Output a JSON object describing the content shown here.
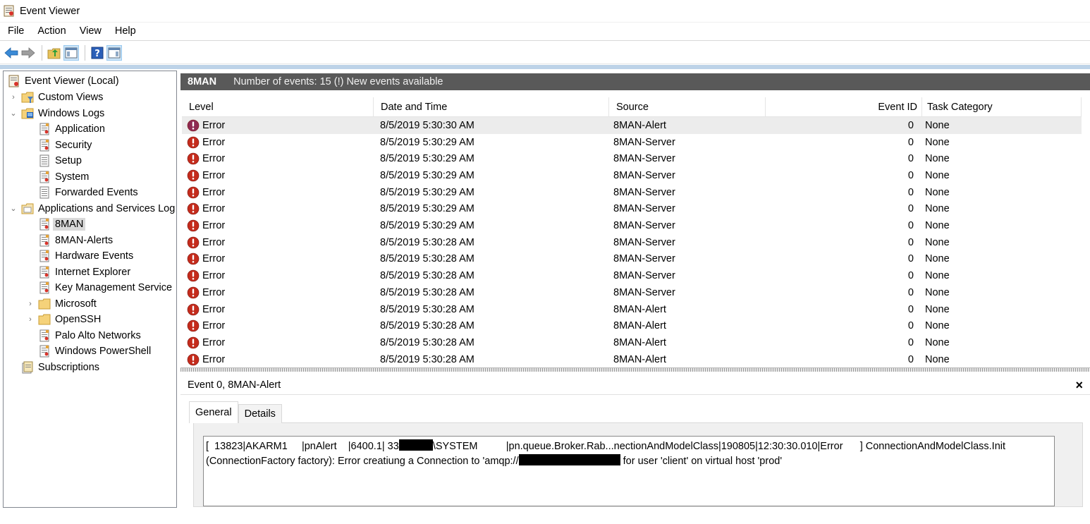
{
  "window": {
    "title": "Event Viewer"
  },
  "menu": [
    "File",
    "Action",
    "View",
    "Help"
  ],
  "toolbar": [
    "back-icon",
    "forward-icon",
    "up-folder-icon",
    "show-hide-console-tree-icon",
    "help-icon",
    "show-hide-action-pane-icon"
  ],
  "tree": {
    "root": "Event Viewer (Local)",
    "items": [
      {
        "label": "Custom Views",
        "icon": "custom-views-icon",
        "expander": "›",
        "level": 1
      },
      {
        "label": "Windows Logs",
        "icon": "windows-logs-icon",
        "expander": "⌄",
        "level": 1
      },
      {
        "label": "Application",
        "icon": "log-icon",
        "level": 2
      },
      {
        "label": "Security",
        "icon": "log-icon",
        "level": 2
      },
      {
        "label": "Setup",
        "icon": "log-plain-icon",
        "level": 2
      },
      {
        "label": "System",
        "icon": "log-icon",
        "level": 2
      },
      {
        "label": "Forwarded Events",
        "icon": "log-plain-icon",
        "level": 2
      },
      {
        "label": "Applications and Services Log",
        "icon": "folder-open-icon",
        "expander": "⌄",
        "level": 1
      },
      {
        "label": "8MAN",
        "icon": "log-icon",
        "level": 2,
        "selected": true
      },
      {
        "label": "8MAN-Alerts",
        "icon": "log-icon",
        "level": 2
      },
      {
        "label": "Hardware Events",
        "icon": "log-icon",
        "level": 2
      },
      {
        "label": "Internet Explorer",
        "icon": "log-icon",
        "level": 2
      },
      {
        "label": "Key Management Service",
        "icon": "log-icon",
        "level": 2
      },
      {
        "label": "Microsoft",
        "icon": "folder-icon",
        "expander": "›",
        "level": 2
      },
      {
        "label": "OpenSSH",
        "icon": "folder-icon",
        "expander": "›",
        "level": 2
      },
      {
        "label": "Palo Alto Networks",
        "icon": "log-icon",
        "level": 2
      },
      {
        "label": "Windows PowerShell",
        "icon": "log-icon",
        "level": 2
      },
      {
        "label": "Subscriptions",
        "icon": "subscriptions-icon",
        "level": 1
      }
    ]
  },
  "log": {
    "name": "8MAN",
    "info": "Number of events: 15 (!) New events available"
  },
  "grid": {
    "columns": [
      "Level",
      "Date and Time",
      "Source",
      "Event ID",
      "Task Category"
    ],
    "rows": [
      {
        "level": "Error",
        "date": "8/5/2019 5:30:30 AM",
        "source": "8MAN-Alert",
        "eid": "0",
        "task": "None",
        "selected": true
      },
      {
        "level": "Error",
        "date": "8/5/2019 5:30:29 AM",
        "source": "8MAN-Server",
        "eid": "0",
        "task": "None"
      },
      {
        "level": "Error",
        "date": "8/5/2019 5:30:29 AM",
        "source": "8MAN-Server",
        "eid": "0",
        "task": "None"
      },
      {
        "level": "Error",
        "date": "8/5/2019 5:30:29 AM",
        "source": "8MAN-Server",
        "eid": "0",
        "task": "None"
      },
      {
        "level": "Error",
        "date": "8/5/2019 5:30:29 AM",
        "source": "8MAN-Server",
        "eid": "0",
        "task": "None"
      },
      {
        "level": "Error",
        "date": "8/5/2019 5:30:29 AM",
        "source": "8MAN-Server",
        "eid": "0",
        "task": "None"
      },
      {
        "level": "Error",
        "date": "8/5/2019 5:30:29 AM",
        "source": "8MAN-Server",
        "eid": "0",
        "task": "None"
      },
      {
        "level": "Error",
        "date": "8/5/2019 5:30:28 AM",
        "source": "8MAN-Server",
        "eid": "0",
        "task": "None"
      },
      {
        "level": "Error",
        "date": "8/5/2019 5:30:28 AM",
        "source": "8MAN-Server",
        "eid": "0",
        "task": "None"
      },
      {
        "level": "Error",
        "date": "8/5/2019 5:30:28 AM",
        "source": "8MAN-Server",
        "eid": "0",
        "task": "None"
      },
      {
        "level": "Error",
        "date": "8/5/2019 5:30:28 AM",
        "source": "8MAN-Server",
        "eid": "0",
        "task": "None"
      },
      {
        "level": "Error",
        "date": "8/5/2019 5:30:28 AM",
        "source": "8MAN-Alert",
        "eid": "0",
        "task": "None"
      },
      {
        "level": "Error",
        "date": "8/5/2019 5:30:28 AM",
        "source": "8MAN-Alert",
        "eid": "0",
        "task": "None"
      },
      {
        "level": "Error",
        "date": "8/5/2019 5:30:28 AM",
        "source": "8MAN-Alert",
        "eid": "0",
        "task": "None"
      },
      {
        "level": "Error",
        "date": "8/5/2019 5:30:28 AM",
        "source": "8MAN-Alert",
        "eid": "0",
        "task": "None"
      }
    ]
  },
  "preview": {
    "title": "Event 0, 8MAN-Alert",
    "close": "×",
    "tabs": [
      "General",
      "Details"
    ],
    "message": {
      "line1_a": "[  13823|AKARM1     |pnAlert    |6400.1| 33",
      "line1_b": "\\SYSTEM          |pn.queue.Broker.Rab...nectionAndModelClass|190805|12:30:30.010|Error      ] ConnectionAndModelClass.Init",
      "line2_a": "(ConnectionFactory factory): Error creatiung a Connection to 'amqp://",
      "line2_b": " for user 'client' on virtual host 'prod'"
    }
  },
  "colors": {
    "log_header_bg": "#595959",
    "error_red": "#c42b1c",
    "selected_row": "#ececec"
  }
}
